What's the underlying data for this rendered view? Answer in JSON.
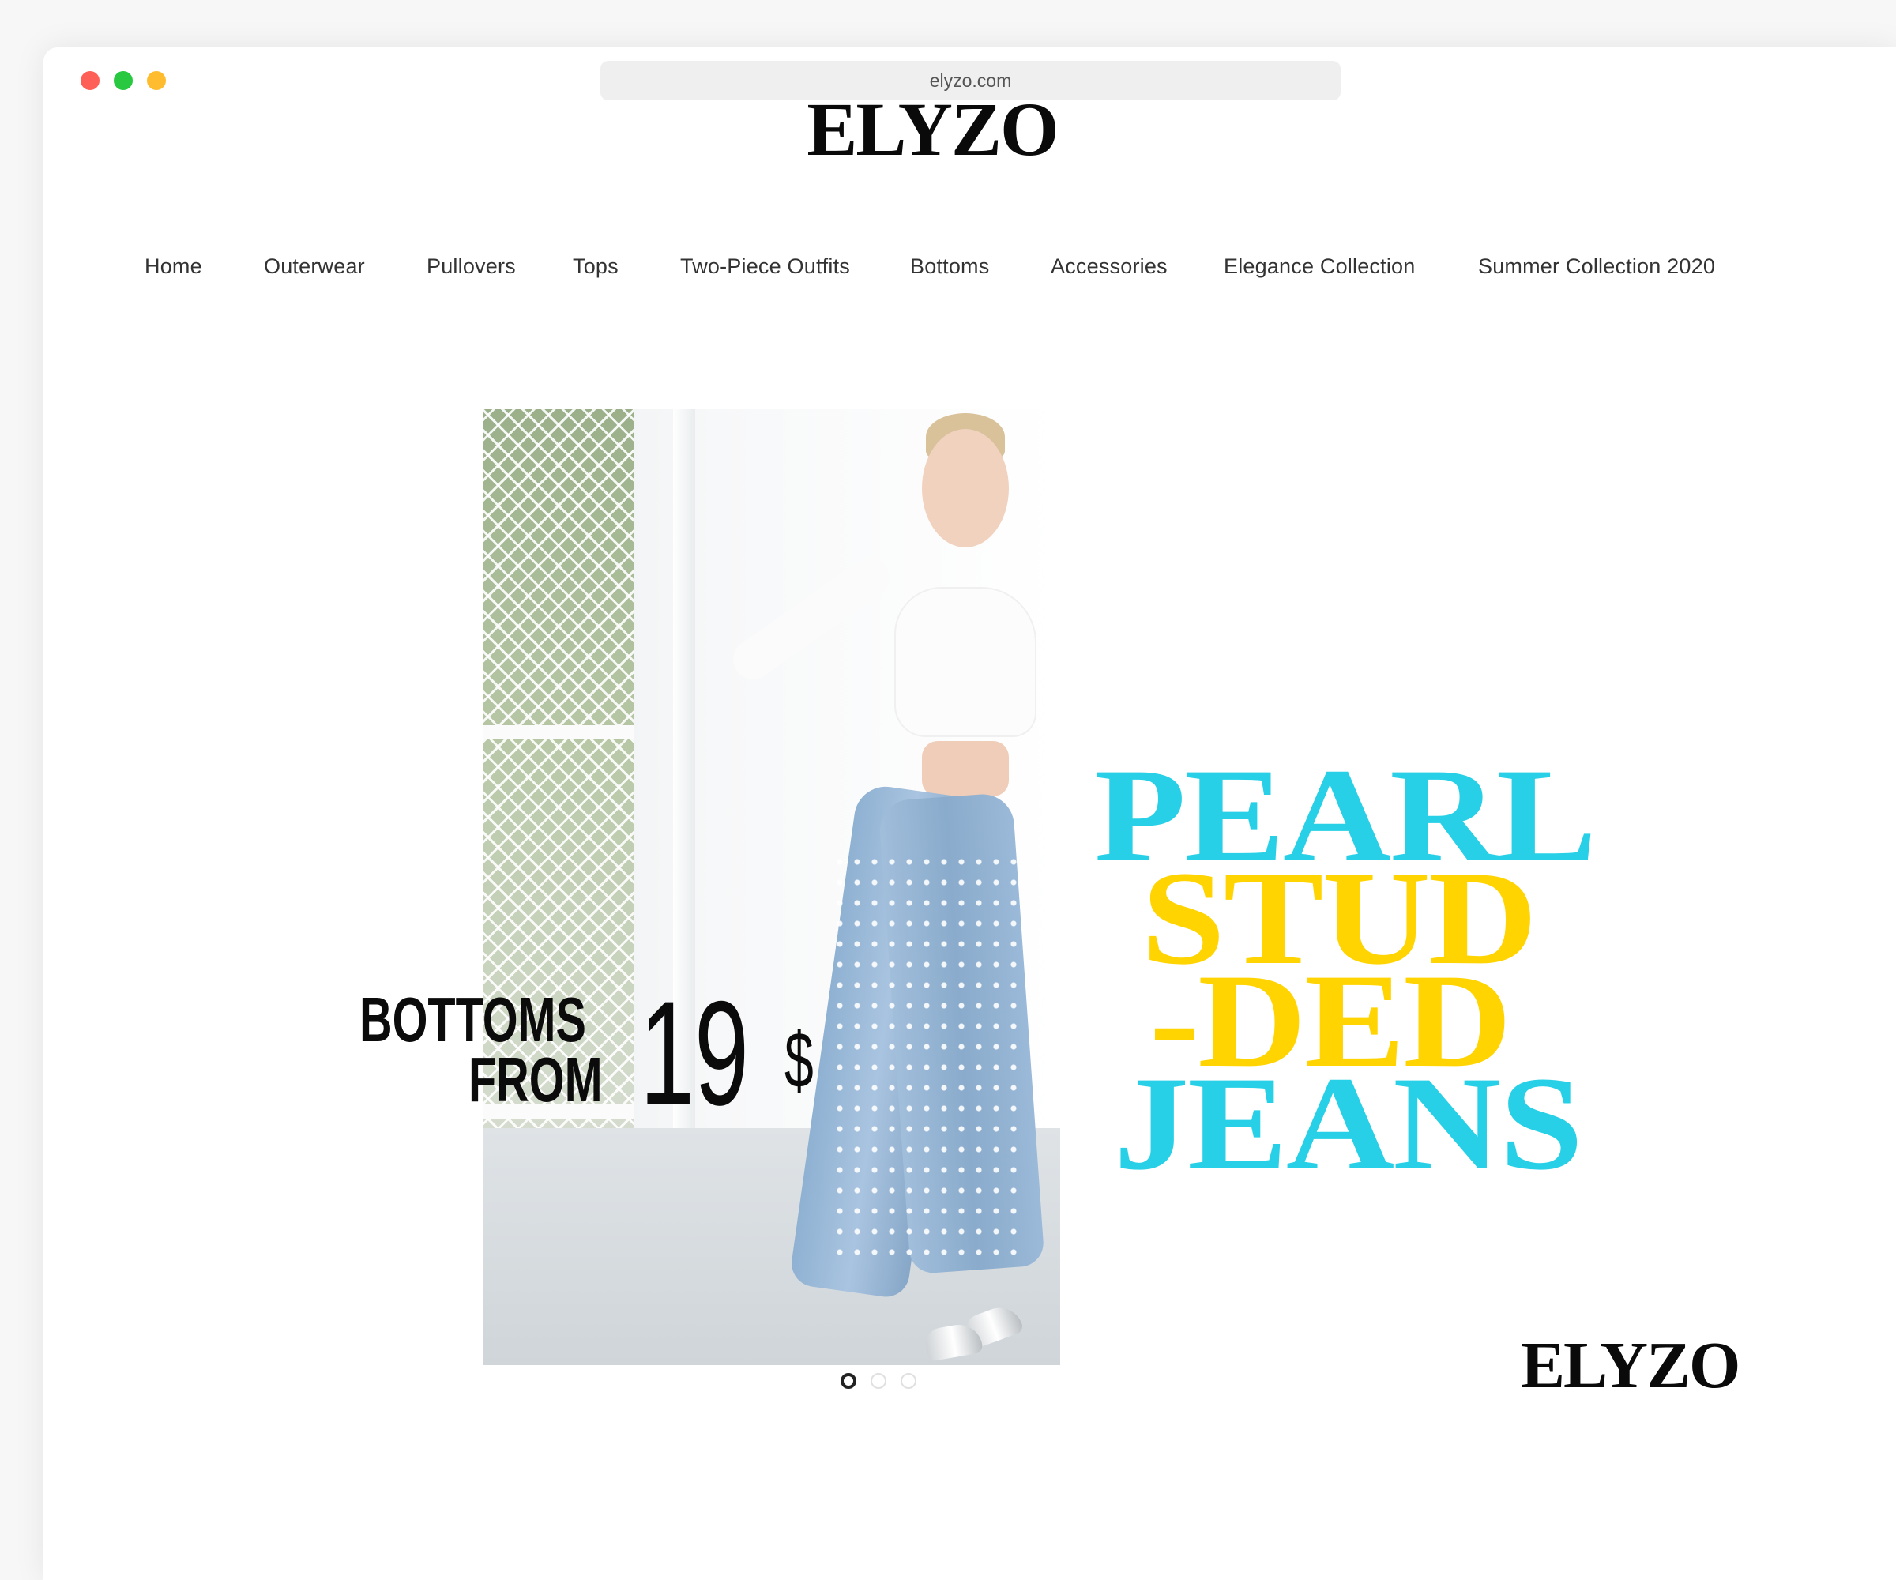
{
  "browser": {
    "url": "elyzo.com"
  },
  "site": {
    "logo": "ELYZO"
  },
  "nav": {
    "items": [
      {
        "label": "Home"
      },
      {
        "label": "Outerwear"
      },
      {
        "label": "Pullovers"
      },
      {
        "label": "Tops"
      },
      {
        "label": "Two-Piece Outfits"
      },
      {
        "label": "Bottoms"
      },
      {
        "label": "Accessories"
      },
      {
        "label": "Elegance Collection"
      },
      {
        "label": "Summer Collection 2020"
      }
    ]
  },
  "hero": {
    "promo_line1": "BOTTOMS",
    "promo_line2": "FROM",
    "promo_price": "19",
    "promo_currency": "$",
    "headline_line1": "PEARL",
    "headline_line2": "STUD",
    "headline_line3": "-DED",
    "headline_line4": "JEANS",
    "brand_mark": "ELYZO",
    "colors": {
      "cyan": "#27d0e6",
      "yellow": "#ffd400",
      "black": "#0b0b0b"
    },
    "carousel": {
      "slide_count": 3,
      "active_index": 0
    }
  }
}
